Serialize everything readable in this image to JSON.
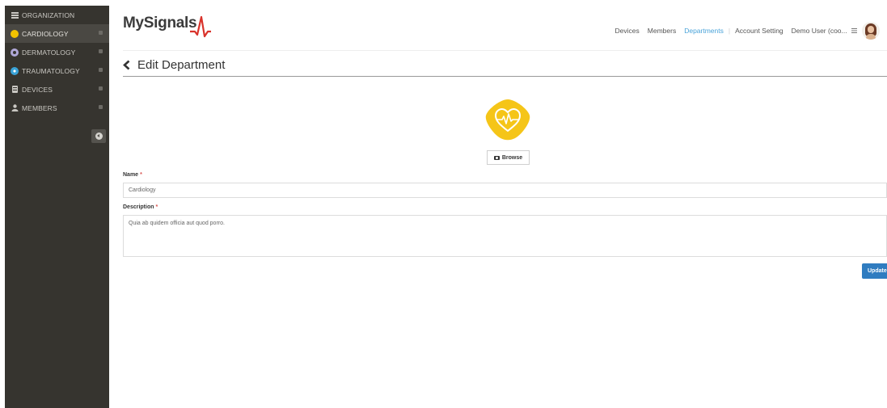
{
  "sidebar": {
    "items": [
      {
        "label": "ORGANIZATION",
        "icon": "list-icon"
      },
      {
        "label": "CARDIOLOGY",
        "icon": "yellow-dot-icon",
        "color": "#f2c200"
      },
      {
        "label": "DERMATOLOGY",
        "icon": "dermatology-icon",
        "color": "#b0a8d8"
      },
      {
        "label": "TRAUMATOLOGY",
        "icon": "traumatology-icon",
        "color": "#3aa3d8"
      },
      {
        "label": "DEVICES",
        "icon": "device-icon"
      },
      {
        "label": "MEMBERS",
        "icon": "user-icon"
      }
    ]
  },
  "header": {
    "logo": "MySignals",
    "nav": [
      "Devices",
      "Members",
      "Departments",
      "Account Setting"
    ],
    "active_nav": "Departments",
    "user": "Demo User (coo...",
    "accent_color": "#4aa3d9"
  },
  "page": {
    "title": "Edit Department"
  },
  "dept_image": {
    "icon": "heart-pulse-icon",
    "color": "#f5c518",
    "browse_label": "Browse"
  },
  "form": {
    "name_label": "Name",
    "name_value": "Cardiology",
    "description_label": "Description",
    "description_value": "Quia ab quidem officia aut quod porro.",
    "required_mark": "*",
    "submit_label": "Update"
  }
}
